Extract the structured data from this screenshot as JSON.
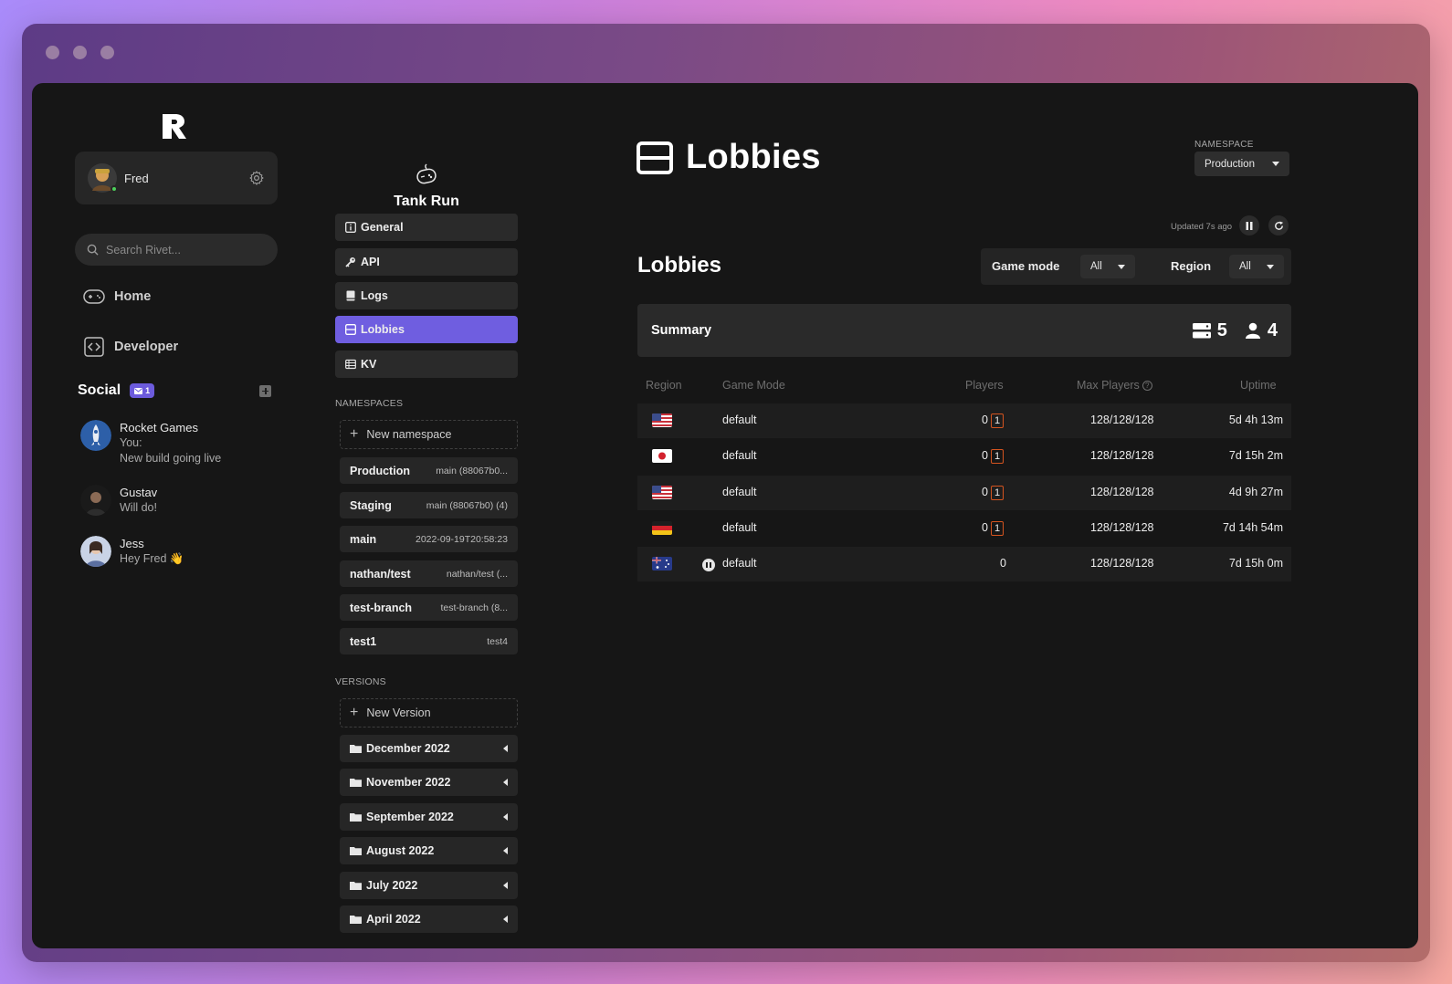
{
  "window": {
    "dots": 3
  },
  "user": {
    "name": "Fred",
    "settings_icon": "gear-icon"
  },
  "search": {
    "placeholder": "Search Rivet..."
  },
  "nav": {
    "home": "Home",
    "developer": "Developer"
  },
  "social": {
    "title": "Social",
    "badge_count": "1",
    "chats": [
      {
        "name": "Rocket Games",
        "line1": "You:",
        "line2": "New build going live"
      },
      {
        "name": "Gustav",
        "line1": "Will do!"
      },
      {
        "name": "Jess",
        "line1": "Hey Fred 👋"
      }
    ]
  },
  "game": {
    "title": "Tank Run"
  },
  "game_menu": [
    {
      "label": "General",
      "icon": "info-icon"
    },
    {
      "label": "API",
      "icon": "key-icon"
    },
    {
      "label": "Logs",
      "icon": "book-icon"
    },
    {
      "label": "Lobbies",
      "icon": "lobbies-icon",
      "active": true
    },
    {
      "label": "KV",
      "icon": "table-icon"
    }
  ],
  "namespaces": {
    "label": "NAMESPACES",
    "new_label": "New namespace",
    "items": [
      {
        "name": "Production",
        "version": "main (88067b0..."
      },
      {
        "name": "Staging",
        "version": "main (88067b0) (4)"
      },
      {
        "name": "main",
        "version": "2022-09-19T20:58:23"
      },
      {
        "name": "nathan/test",
        "version": "nathan/test (..."
      },
      {
        "name": "test-branch",
        "version": "test-branch (8..."
      },
      {
        "name": "test1",
        "version": "test4"
      }
    ]
  },
  "versions": {
    "label": "VERSIONS",
    "new_label": "New Version",
    "items": [
      "December 2022",
      "November 2022",
      "September 2022",
      "August 2022",
      "July 2022",
      "April 2022"
    ]
  },
  "main": {
    "title": "Lobbies",
    "namespace_label": "NAMESPACE",
    "namespace_value": "Production",
    "updated": "Updated 7s ago",
    "section_title": "Lobbies",
    "filters": {
      "game_mode_label": "Game mode",
      "game_mode_value": "All",
      "region_label": "Region",
      "region_value": "All"
    },
    "summary": {
      "title": "Summary",
      "lobbies": "5",
      "players": "4"
    },
    "table": {
      "headers": {
        "region": "Region",
        "game_mode": "Game Mode",
        "players": "Players",
        "max_players": "Max Players",
        "uptime": "Uptime"
      },
      "rows": [
        {
          "flag": "us-flag-icon",
          "mode": "default",
          "players": "0",
          "pending": "1",
          "max": "128/128/128",
          "uptime": "5d 4h 13m"
        },
        {
          "flag": "jp-flag-icon",
          "mode": "default",
          "players": "0",
          "pending": "1",
          "max": "128/128/128",
          "uptime": "7d 15h 2m"
        },
        {
          "flag": "us-flag-icon",
          "mode": "default",
          "players": "0",
          "pending": "1",
          "max": "128/128/128",
          "uptime": "4d 9h 27m"
        },
        {
          "flag": "de-flag-icon",
          "mode": "default",
          "players": "0",
          "pending": "1",
          "max": "128/128/128",
          "uptime": "7d 14h 54m"
        },
        {
          "flag": "au-flag-icon",
          "mode": "default",
          "players": "0",
          "pending": "",
          "max": "128/128/128",
          "uptime": "7d 15h 0m",
          "paused": true
        }
      ]
    }
  },
  "colors": {
    "accent": "#6f5ee0",
    "bg": "#161616",
    "panel": "#2a2a2a",
    "warn": "#d4541f"
  }
}
